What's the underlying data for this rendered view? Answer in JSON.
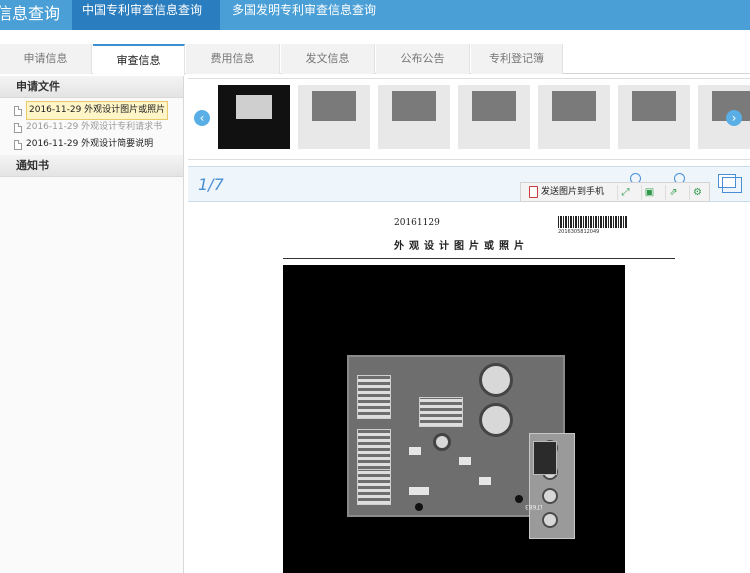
{
  "header": {
    "app_title": "信息查询",
    "nav_tabs": [
      {
        "label": "中国专利审查信息查询",
        "active": true
      },
      {
        "label": "多国发明专利审查信息查询",
        "active": false
      }
    ]
  },
  "tabs": [
    "申请信息",
    "审查信息",
    "费用信息",
    "发文信息",
    "公布公告",
    "专利登记簿"
  ],
  "active_tab": "审查信息",
  "sidebar": {
    "section_application_files": "申请文件",
    "files": [
      {
        "label": "2016-11-29 外观设计图片或照片",
        "selected": true
      },
      {
        "label": "2016-11-29 外观设计专利请求书",
        "selected": false
      },
      {
        "label": "2016-11-29 外观设计简要说明",
        "selected": false
      }
    ],
    "section_notices": "通知书"
  },
  "viewer": {
    "page_indicator": "1/7",
    "thumbnail_count": 7,
    "toolbar": {
      "send_to_phone_label": "发送图片到手机",
      "send_icon": "phone-icon",
      "buttons": [
        "fullscreen-icon",
        "save-icon",
        "export-icon",
        "settings-icon"
      ]
    },
    "document": {
      "date": "20161129",
      "barcode_number": "2016305812049",
      "title": "外观设计图片或照片",
      "photo_text": "LT683"
    }
  },
  "colors": {
    "header_bg": "#4a9fd6",
    "active_header_tab": "#2a7dbf",
    "accent": "#4a8fd6",
    "selected_file_bg": "#fff5c7"
  }
}
